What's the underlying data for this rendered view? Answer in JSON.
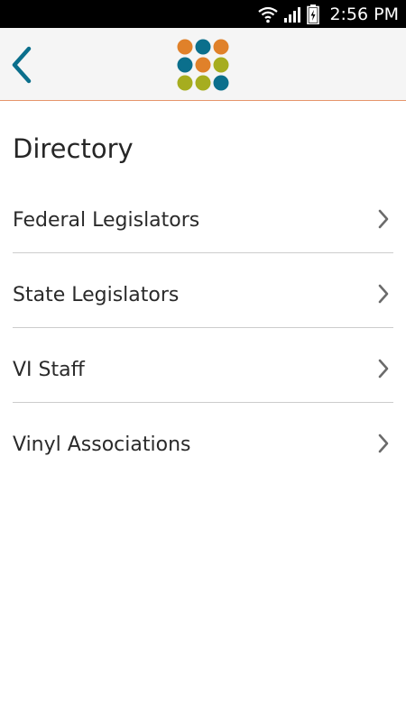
{
  "status_bar": {
    "time": "2:56 PM",
    "icons": [
      "wifi-icon",
      "signal-icon",
      "battery-charging-icon"
    ]
  },
  "app_bar": {
    "back_icon": "chevron-left-icon",
    "logo": "dot-grid-logo",
    "colors": {
      "accent": "#0b6f8c",
      "orange": "#e0812a",
      "olive": "#a6ad1f",
      "divider": "#e6956b"
    }
  },
  "page": {
    "title": "Directory"
  },
  "menu": {
    "items": [
      {
        "label": "Federal Legislators",
        "icon": "chevron-right-icon"
      },
      {
        "label": "State Legislators",
        "icon": "chevron-right-icon"
      },
      {
        "label": "VI Staff",
        "icon": "chevron-right-icon"
      },
      {
        "label": "Vinyl Associations",
        "icon": "chevron-right-icon"
      }
    ]
  }
}
